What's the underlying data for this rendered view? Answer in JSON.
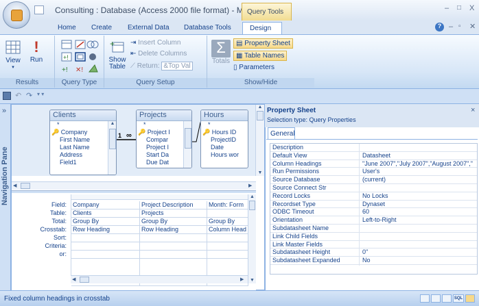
{
  "title_bar": {
    "title": "Consulting : Database (Access 2000 file format) - M..",
    "context_tab": "Query Tools",
    "minimize": "–",
    "maximize": "□",
    "close": "X"
  },
  "tabs": [
    "Home",
    "Create",
    "External Data",
    "Database Tools",
    "Design"
  ],
  "ribbon": {
    "results": {
      "view": "View",
      "run": "Run",
      "label": "Results"
    },
    "query_type": {
      "label": "Query Type"
    },
    "query_setup": {
      "show_table": "Show Table",
      "insert_column": "Insert Column",
      "delete_columns": "Delete Columns",
      "return_label": "Return:",
      "return_value": "&Top Val",
      "label": "Query Setup"
    },
    "show_hide": {
      "totals": "Totals",
      "property_sheet": "Property Sheet",
      "table_names": "Table Names",
      "parameters": "Parameters",
      "label": "Show/Hide"
    }
  },
  "nav_pane": {
    "label": "Navigation Pane",
    "toggle": "»"
  },
  "tables": [
    {
      "name": "Clients",
      "fields": [
        "*",
        "Company",
        "First Name",
        "Last Name",
        "Address",
        "Field1"
      ]
    },
    {
      "name": "Projects",
      "fields": [
        "*",
        "Project I",
        "Compar",
        "Project I",
        "Start Da",
        "Due Dat"
      ]
    },
    {
      "name": "Hours",
      "fields": [
        "*",
        "Hours ID",
        "ProjectID",
        "Date",
        "Hours wor"
      ]
    }
  ],
  "join": {
    "one": "1",
    "many": "∞"
  },
  "grid": {
    "row_labels": [
      "Field:",
      "Table:",
      "Total:",
      "Crosstab:",
      "Sort:",
      "Criteria:",
      "or:"
    ],
    "columns": [
      [
        "Company",
        "Clients",
        "Group By",
        "Row Heading",
        "",
        "",
        ""
      ],
      [
        "Project Description",
        "Projects",
        "Group By",
        "Row Heading",
        "",
        "",
        ""
      ],
      [
        "Month: Form",
        "",
        "Group By",
        "Column Head",
        "",
        "",
        ""
      ]
    ]
  },
  "property_sheet": {
    "title": "Property Sheet",
    "selection_type": "Selection type: Query Properties",
    "tab": "General",
    "close": "×",
    "rows": [
      [
        "Description",
        ""
      ],
      [
        "Default View",
        "Datasheet"
      ],
      [
        "Column Headings",
        "\"June 2007\",\"July 2007\",\"August 2007\",\""
      ],
      [
        "Run Permissions",
        "User's"
      ],
      [
        "Source Database",
        "(current)"
      ],
      [
        "Source Connect Str",
        ""
      ],
      [
        "Record Locks",
        "No Locks"
      ],
      [
        "Recordset Type",
        "Dynaset"
      ],
      [
        "ODBC Timeout",
        "60"
      ],
      [
        "Orientation",
        "Left-to-Right"
      ],
      [
        "Subdatasheet Name",
        ""
      ],
      [
        "Link Child Fields",
        ""
      ],
      [
        "Link Master Fields",
        ""
      ],
      [
        "Subdatasheet Height",
        "0\""
      ],
      [
        "Subdatasheet Expanded",
        "No"
      ]
    ]
  },
  "status": {
    "text": "Fixed column headings in crosstab",
    "sql": "SQL"
  }
}
